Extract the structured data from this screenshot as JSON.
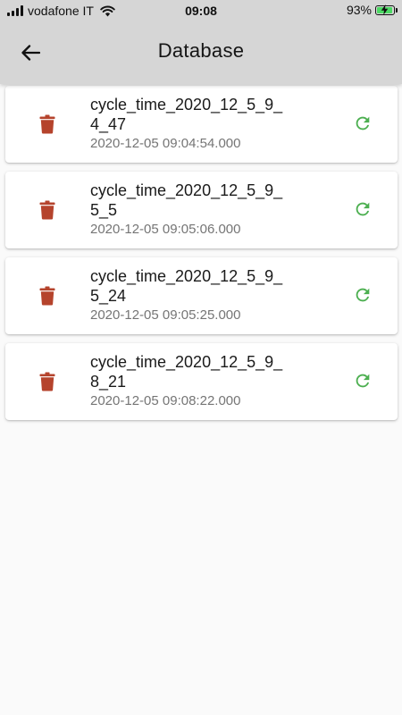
{
  "status_bar": {
    "carrier": "vodafone IT",
    "time": "09:08",
    "battery_percent": "93%",
    "battery_level": 0.93,
    "signal_bars": 4
  },
  "app_bar": {
    "title": "Database",
    "back_icon": "arrow-back-icon"
  },
  "colors": {
    "header_bg": "#d6d6d6",
    "delete_icon": "#b5432c",
    "restore_icon": "#4caf50",
    "battery_fill": "#4cd964"
  },
  "records": [
    {
      "name_line1": "cycle_time_2020_12_5_9_",
      "name_line2": "4_47",
      "date": "2020-12-05 09:04:54.000",
      "delete_icon": "trash-icon",
      "restore_icon": "refresh-icon"
    },
    {
      "name_line1": "cycle_time_2020_12_5_9_",
      "name_line2": "5_5",
      "date": "2020-12-05 09:05:06.000",
      "delete_icon": "trash-icon",
      "restore_icon": "refresh-icon"
    },
    {
      "name_line1": "cycle_time_2020_12_5_9_",
      "name_line2": "5_24",
      "date": "2020-12-05 09:05:25.000",
      "delete_icon": "trash-icon",
      "restore_icon": "refresh-icon"
    },
    {
      "name_line1": "cycle_time_2020_12_5_9_",
      "name_line2": "8_21",
      "date": "2020-12-05 09:08:22.000",
      "delete_icon": "trash-icon",
      "restore_icon": "refresh-icon"
    }
  ]
}
